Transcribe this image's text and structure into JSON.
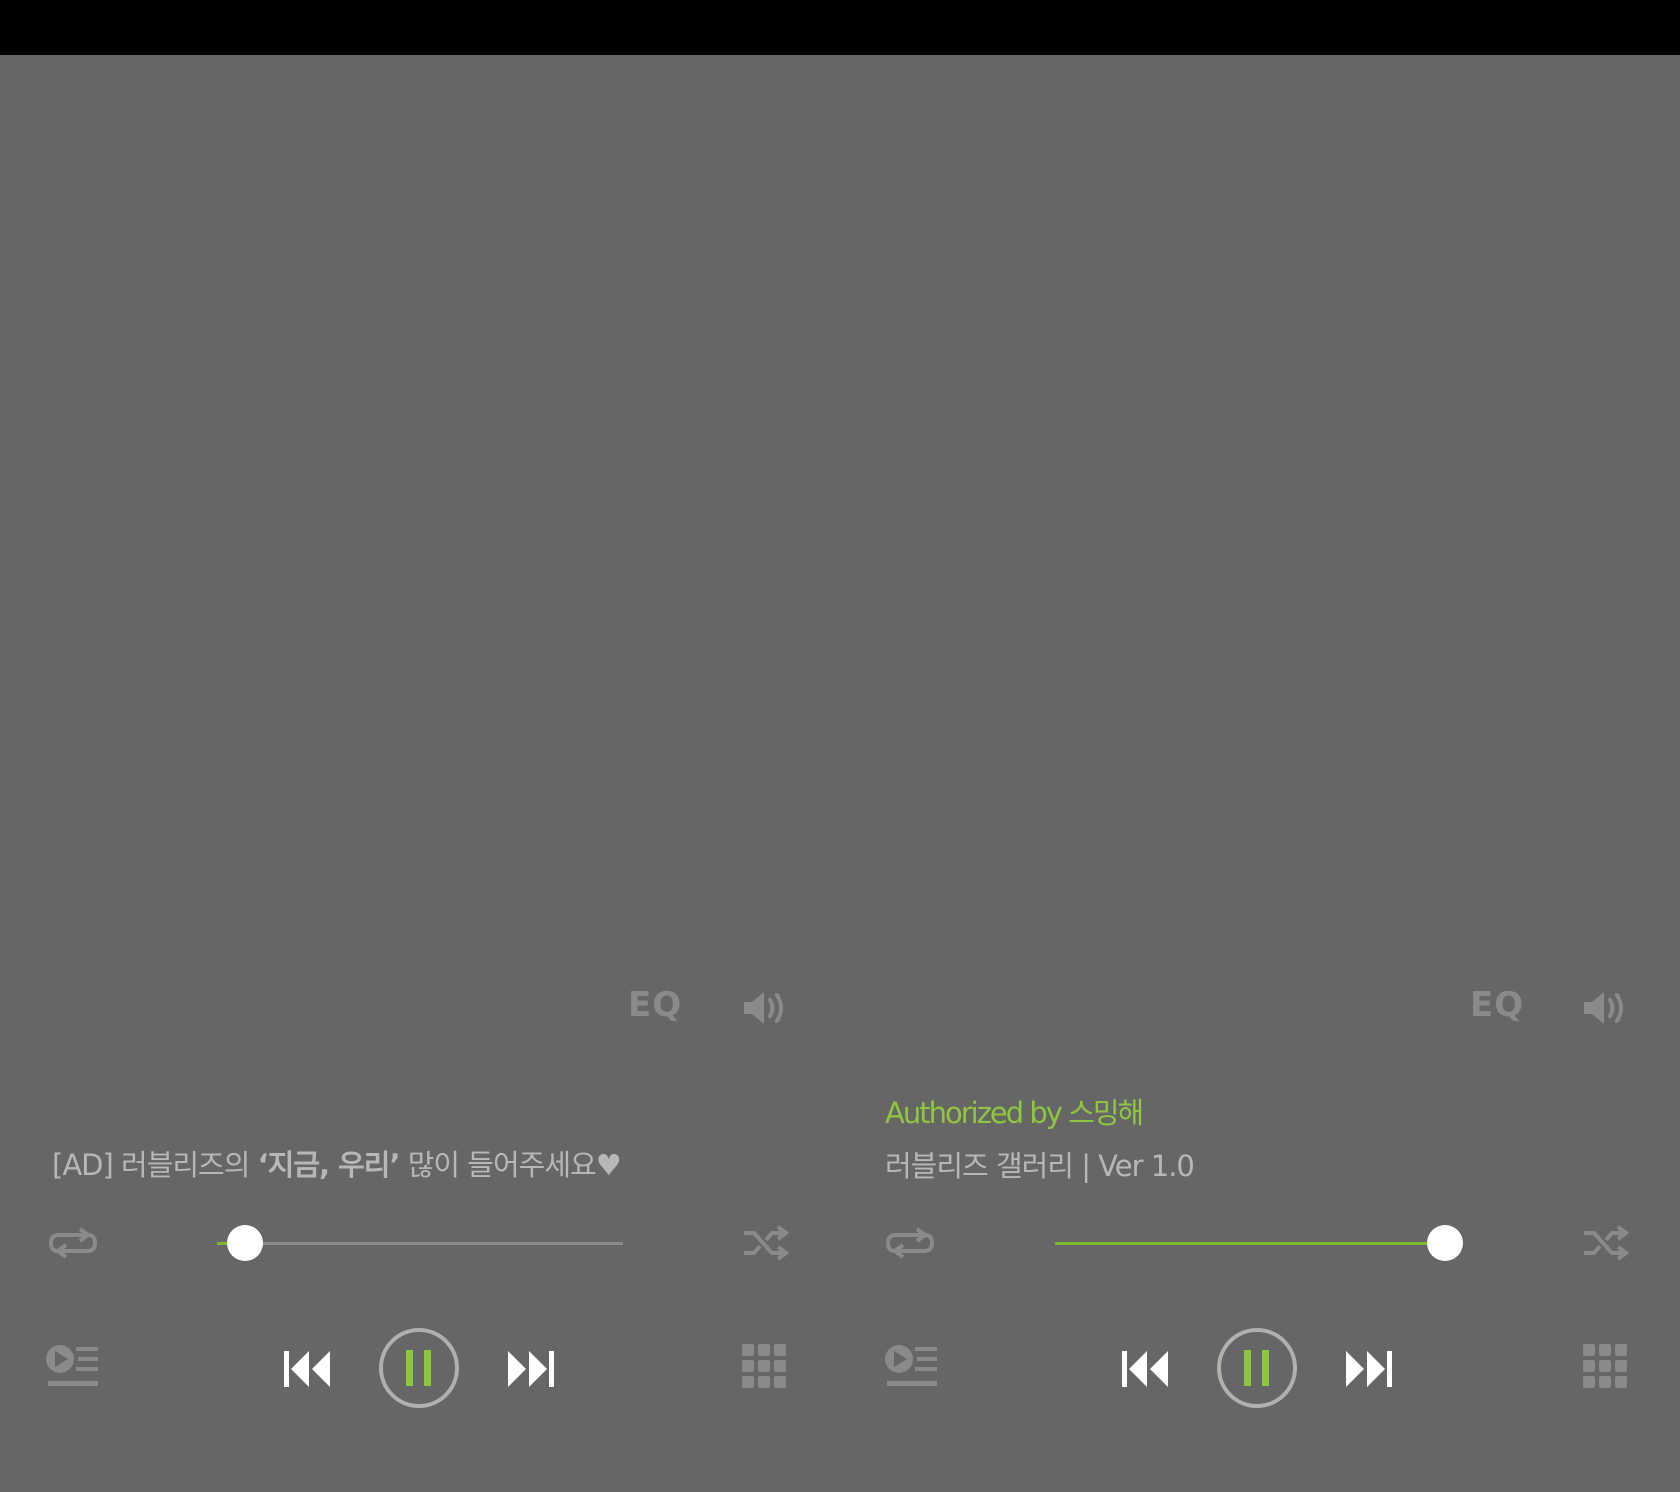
{
  "colors": {
    "background": "#666666",
    "top_bar": "#000000",
    "accent_green": "#8ec63f",
    "icon_gray": "#8a8a8a",
    "text_light": "#b7b7b7"
  },
  "players": [
    {
      "eq_label": "EQ",
      "caption_prefix": "[AD] 러블리즈의 ",
      "caption_bold": "‘지금, 우리’",
      "caption_suffix": " 많이 들어주세요♥",
      "progress": 0.07,
      "play_state": "paused-icon-shown",
      "icons": [
        "volume-icon",
        "repeat-icon",
        "shuffle-icon",
        "playlist-icon",
        "previous-icon",
        "pause-icon",
        "next-icon",
        "menu-grid-icon"
      ]
    },
    {
      "eq_label": "EQ",
      "author_line": "Authorized by 스밍해",
      "version_line": "러블리즈 갤러리 | Ver 1.0",
      "progress": 0.96,
      "play_state": "paused-icon-shown",
      "icons": [
        "volume-icon",
        "repeat-icon",
        "shuffle-icon",
        "playlist-icon",
        "previous-icon",
        "pause-icon",
        "next-icon",
        "menu-grid-icon"
      ]
    }
  ]
}
